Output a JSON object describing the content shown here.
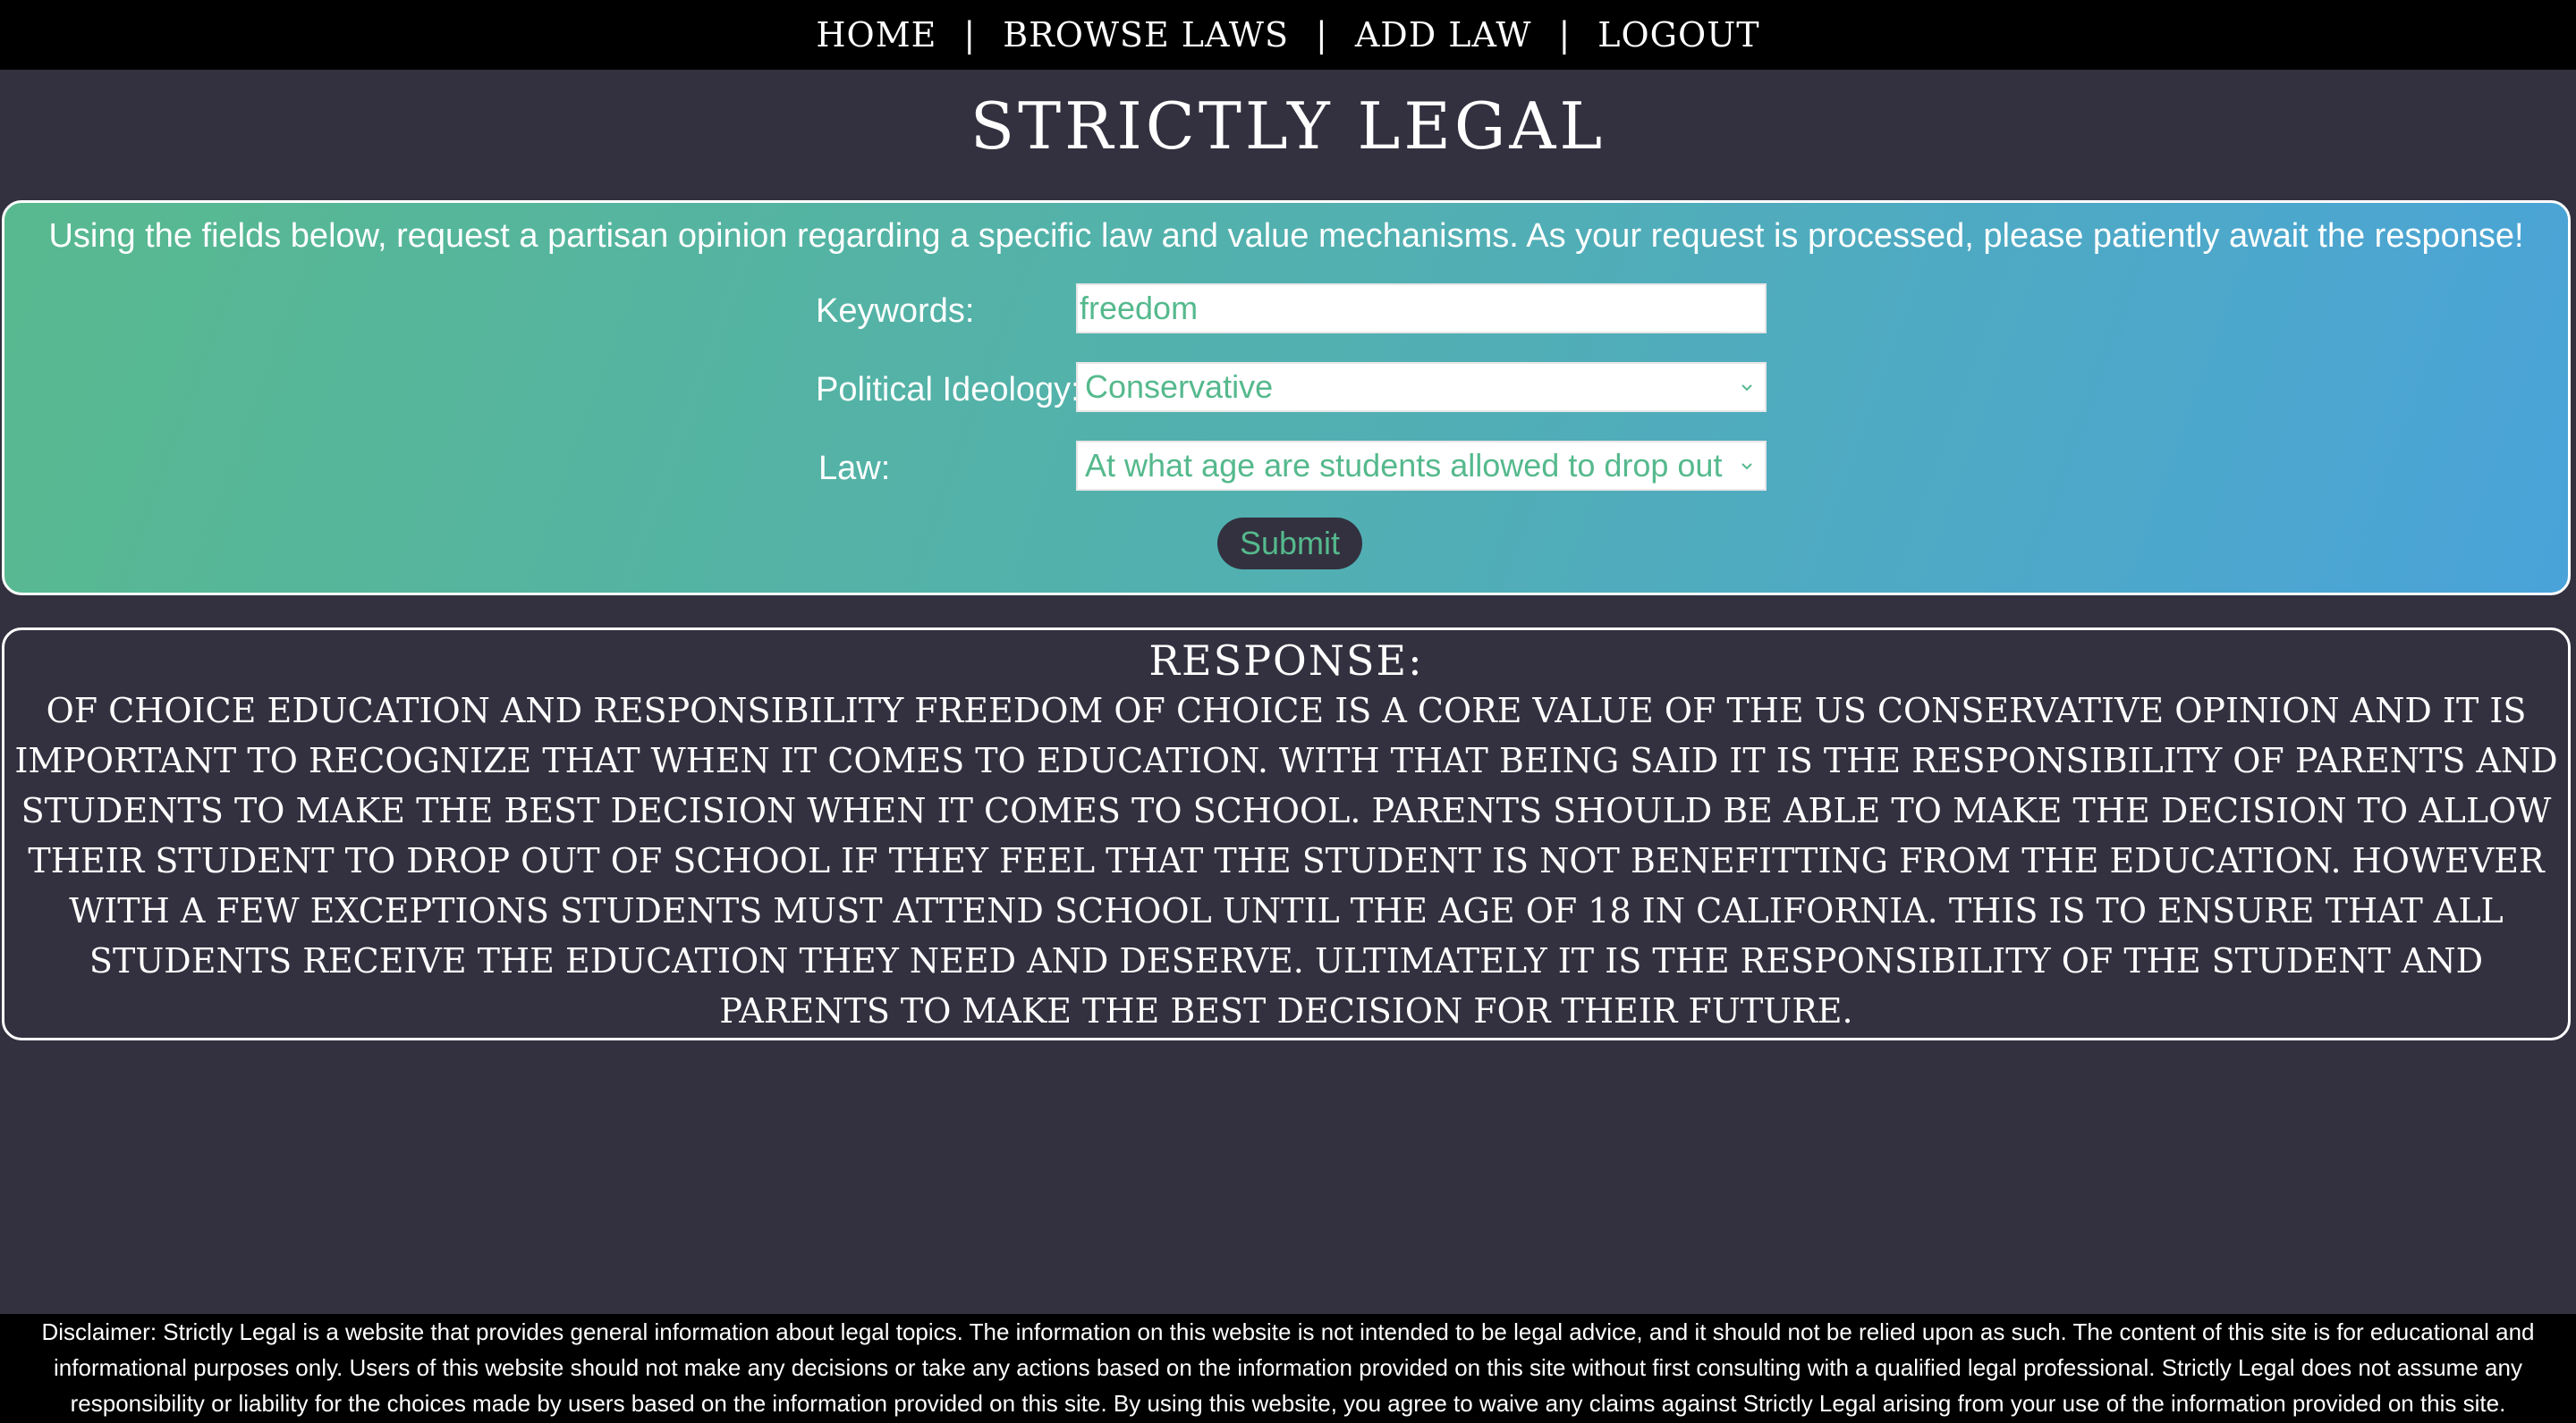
{
  "nav": {
    "items": [
      "HOME",
      "BROWSE LAWS",
      "ADD LAW",
      "LOGOUT"
    ],
    "separator": "|"
  },
  "site": {
    "title": "STRICTLY LEGAL"
  },
  "request_form": {
    "instructions": "Using the fields below, request a partisan opinion regarding a specific law and value mechanisms. As your request is processed, please patiently await the response!",
    "keywords_label": "Keywords:",
    "keywords_value": "freedom",
    "ideology_label": "Political Ideology:",
    "ideology_selected": "Conservative",
    "law_label": "Law:",
    "law_selected": "At what age are students allowed to drop out of school?",
    "submit_label": "Submit"
  },
  "response": {
    "heading": "RESPONSE:",
    "text": "OF CHOICE EDUCATION AND RESPONSIBILITY FREEDOM OF CHOICE IS A CORE VALUE OF THE US CONSERVATIVE OPINION AND IT IS IMPORTANT TO RECOGNIZE THAT WHEN IT COMES TO EDUCATION. WITH THAT BEING SAID IT IS THE RESPONSIBILITY OF PARENTS AND STUDENTS TO MAKE THE BEST DECISION WHEN IT COMES TO SCHOOL. PARENTS SHOULD BE ABLE TO MAKE THE DECISION TO ALLOW THEIR STUDENT TO DROP OUT OF SCHOOL IF THEY FEEL THAT THE STUDENT IS NOT BENEFITTING FROM THE EDUCATION. HOWEVER WITH A FEW EXCEPTIONS STUDENTS MUST ATTEND SCHOOL UNTIL THE AGE OF 18 IN CALIFORNIA. THIS IS TO ENSURE THAT ALL STUDENTS RECEIVE THE EDUCATION THEY NEED AND DESERVE. ULTIMATELY IT IS THE RESPONSIBILITY OF THE STUDENT AND PARENTS TO MAKE THE BEST DECISION FOR THEIR FUTURE."
  },
  "footer": {
    "disclaimer": "Disclaimer: Strictly Legal is a website that provides general information about legal topics. The information on this website is not intended to be legal advice, and it should not be relied upon as such. The content of this site is for educational and informational purposes only. Users of this website should not make any decisions or take any actions based on the information provided on this site without first consulting with a qualified legal professional. Strictly Legal does not assume any responsibility or liability for the choices made by users based on the information provided on this site. By using this website, you agree to waive any claims against Strictly Legal arising from your use of the information provided on this site."
  },
  "colors": {
    "background": "#33313f",
    "nav_background": "#000000",
    "gradient_start": "#58b98f",
    "gradient_end": "#4aa3d9",
    "accent_text": "#55b98d"
  },
  "icons": {
    "select_arrow": "chevron-down-icon"
  }
}
